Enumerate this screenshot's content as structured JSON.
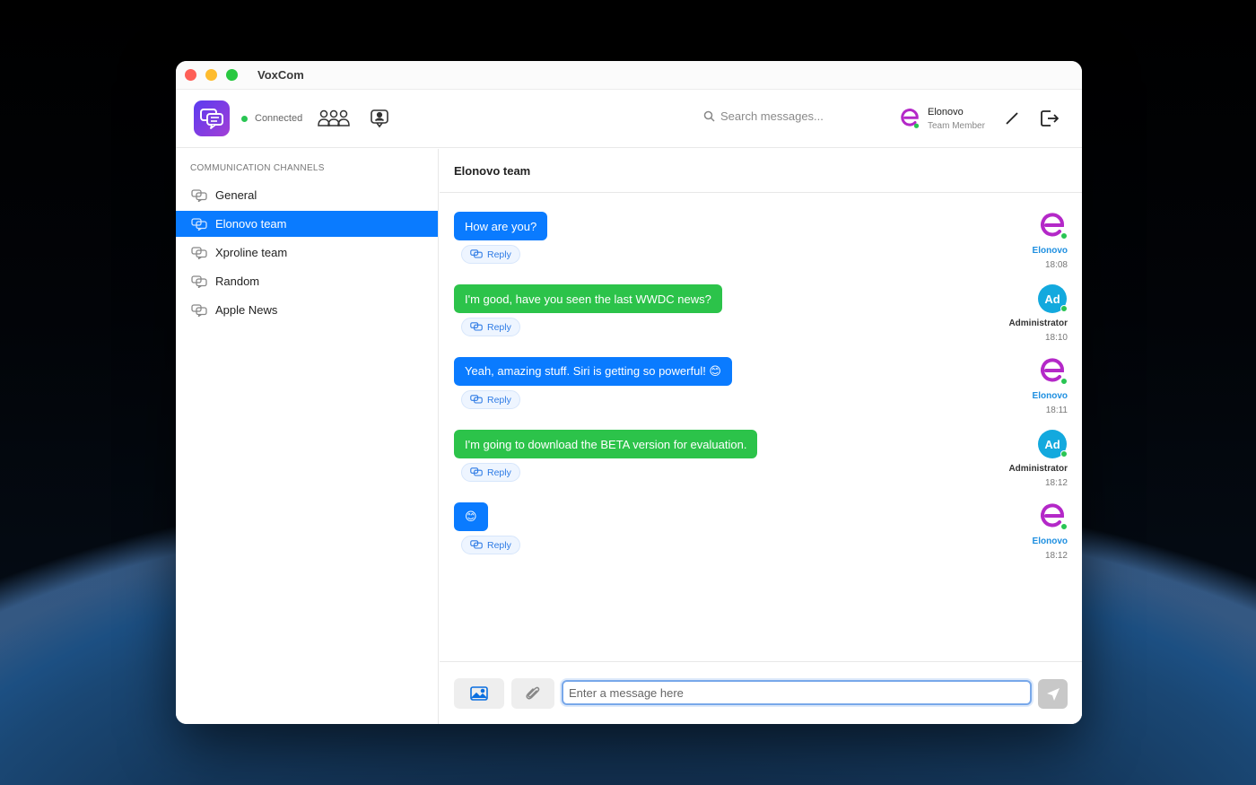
{
  "window": {
    "title": "VoxCom"
  },
  "toolbar": {
    "status": "Connected",
    "search_placeholder": "Search messages...",
    "user_name": "Elonovo",
    "user_role": "Team Member",
    "icons": [
      "chat-logo-icon",
      "team-icon",
      "contact-icon",
      "search-icon",
      "pencil-icon",
      "logout-icon"
    ]
  },
  "sidebar": {
    "heading": "COMMUNICATION CHANNELS",
    "channels": [
      {
        "label": "General",
        "active": false
      },
      {
        "label": "Elonovo team",
        "active": true
      },
      {
        "label": "Xproline team",
        "active": false
      },
      {
        "label": "Random",
        "active": false
      },
      {
        "label": "Apple News",
        "active": false
      }
    ]
  },
  "chat": {
    "title": "Elonovo team",
    "reply_label": "Reply",
    "messages": [
      {
        "text": "How are you?",
        "color": "blue",
        "sender": "Elonovo",
        "time": "18:08",
        "avatar": "E"
      },
      {
        "text": "I'm good, have you seen the last WWDC news?",
        "color": "green",
        "sender": "Administrator",
        "time": "18:10",
        "avatar": "Ad"
      },
      {
        "text": "Yeah, amazing stuff. Siri is getting so powerful! 😊",
        "color": "blue",
        "sender": "Elonovo",
        "time": "18:11",
        "avatar": "E"
      },
      {
        "text": "I'm going to download the BETA version for evaluation.",
        "color": "green",
        "sender": "Administrator",
        "time": "18:12",
        "avatar": "Ad"
      },
      {
        "text": "😊",
        "color": "blue",
        "sender": "Elonovo",
        "time": "18:12",
        "avatar": "E"
      }
    ]
  },
  "composer": {
    "placeholder": "Enter a message here"
  },
  "colors": {
    "accent": "#0a7bff",
    "green_bubble": "#2cc34a",
    "elonovo_brand": "#b428c8",
    "admin_avatar": "#13a9de"
  }
}
